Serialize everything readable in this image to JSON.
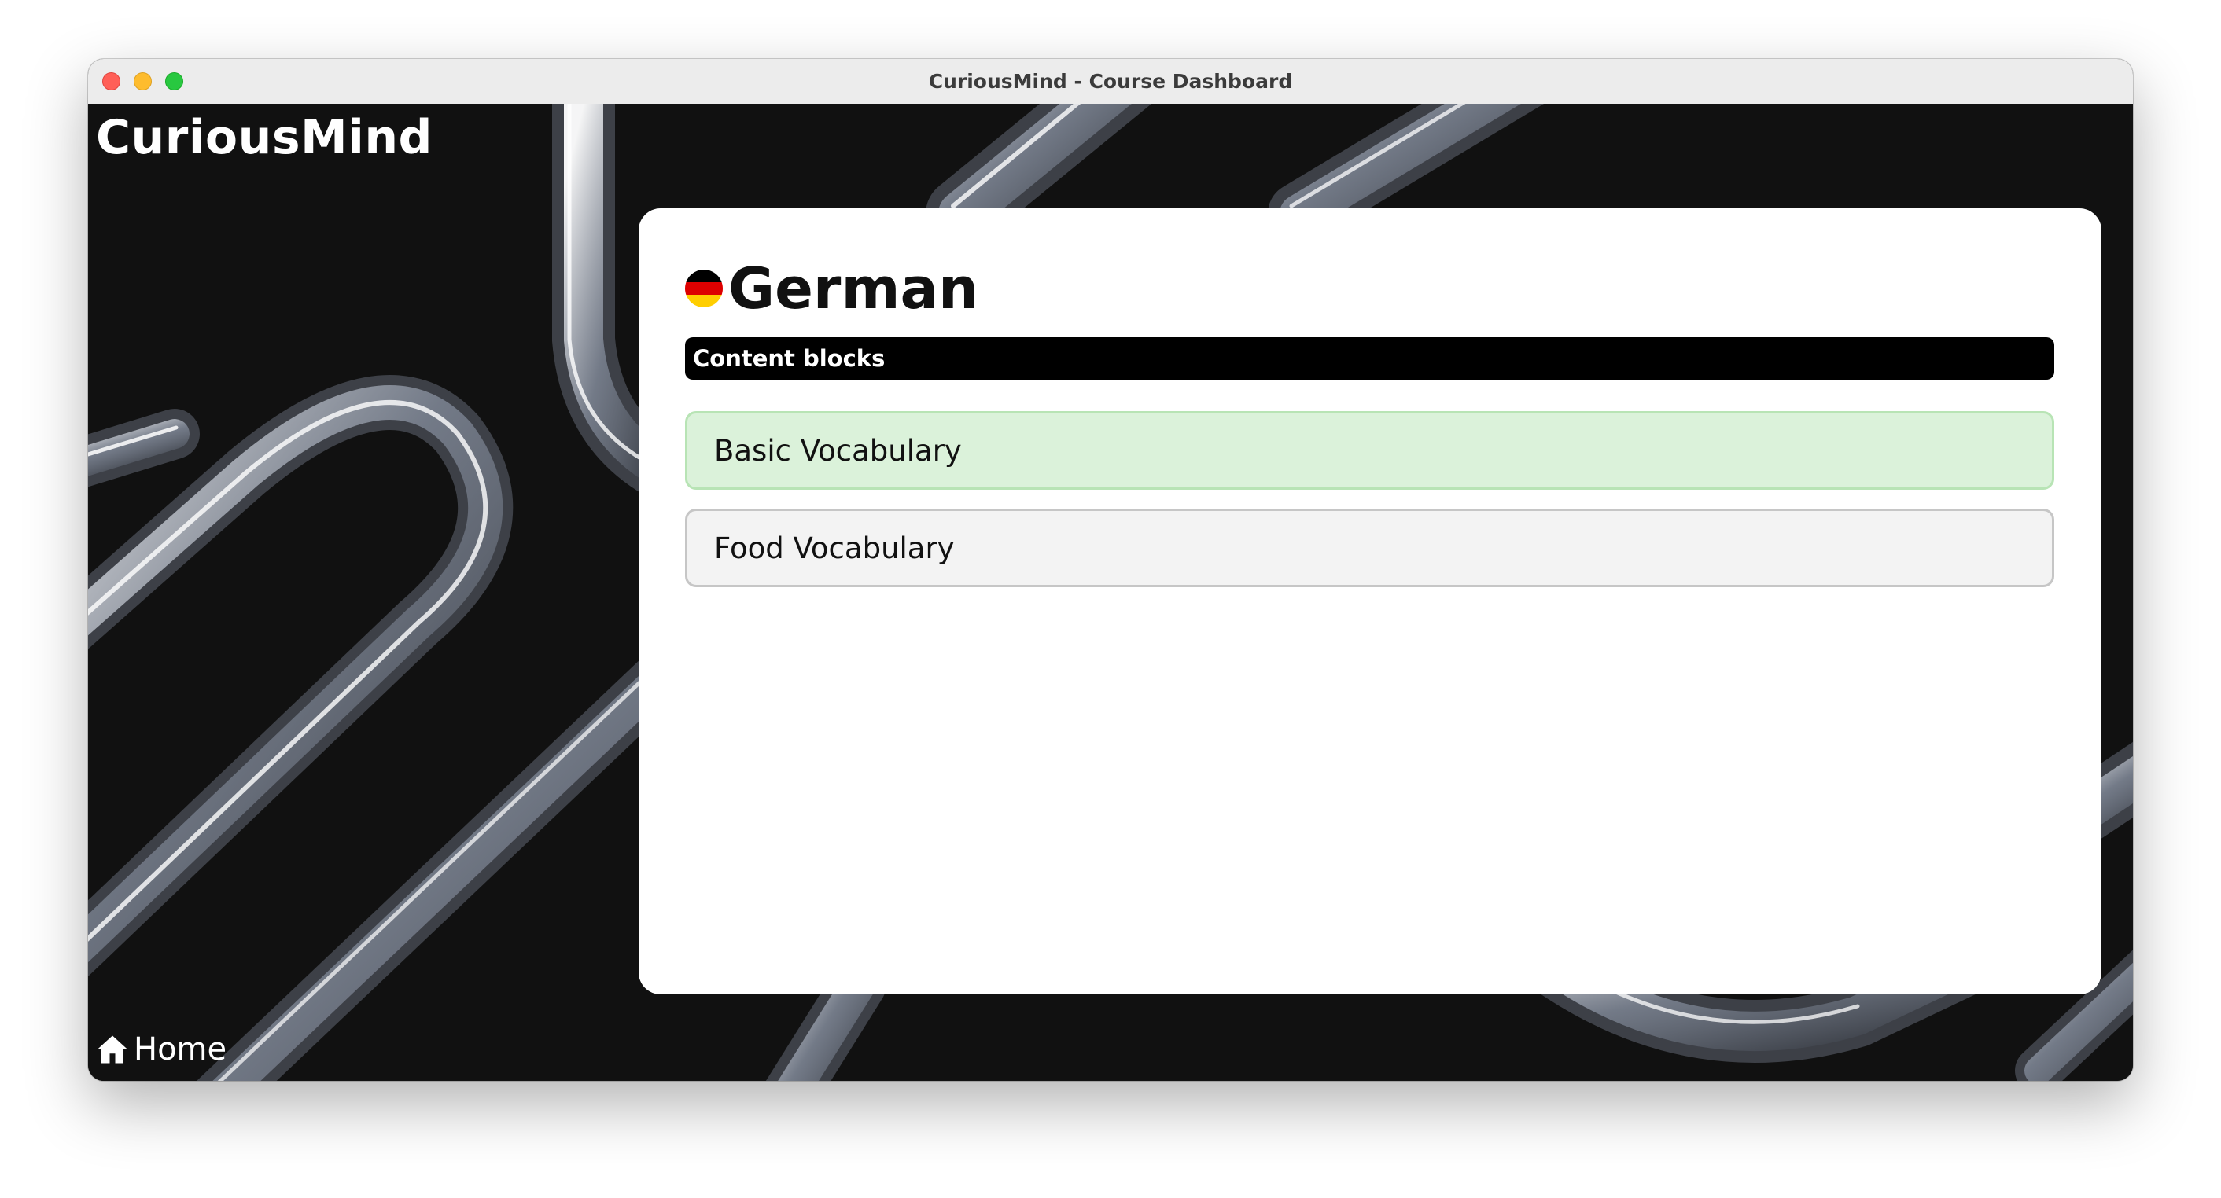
{
  "window": {
    "title": "CuriousMind - Course Dashboard"
  },
  "app": {
    "brand": "CuriousMind"
  },
  "nav": {
    "home_label": "Home",
    "home_icon": "home-icon"
  },
  "course": {
    "title": "German",
    "flag_icon": "germany-flag-icon",
    "section_label": "Content blocks",
    "blocks": [
      {
        "label": "Basic Vocabulary",
        "state": "completed"
      },
      {
        "label": "Food Vocabulary",
        "state": "default"
      }
    ]
  },
  "colors": {
    "background": "#111111",
    "panel": "#ffffff",
    "section_bar": "#000000",
    "block_active": "#dbf2da",
    "block_default": "#f3f3f3",
    "flag_black": "#000000",
    "flag_red": "#dd0000",
    "flag_gold": "#ffce00"
  }
}
